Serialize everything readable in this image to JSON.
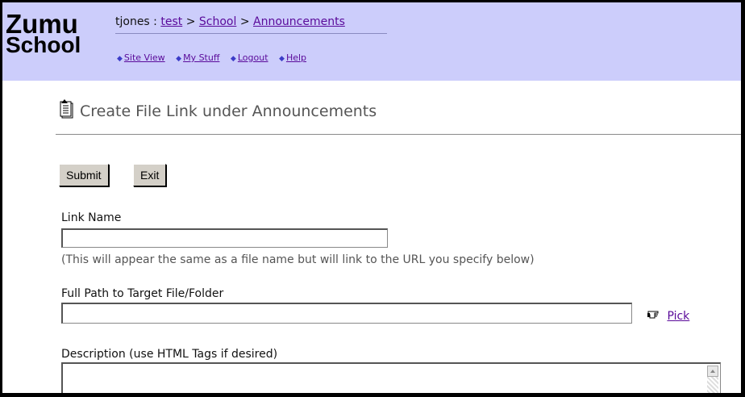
{
  "logo": {
    "line1": "Zumu",
    "line2": "School"
  },
  "breadcrumb": {
    "user": "tjones",
    "sep1": " : ",
    "link1": "test",
    "sep2": " > ",
    "link2": "School",
    "sep3": " > ",
    "link3": "Announcements"
  },
  "nav": {
    "items": [
      "Site View",
      "My Stuff",
      "Logout",
      "Help"
    ]
  },
  "heading": "Create File Link under Announcements",
  "buttons": {
    "submit": "Submit",
    "exit": "Exit"
  },
  "form": {
    "link_name_label": "Link Name",
    "link_name_value": "",
    "hint": "(This will appear the same as a file name but will link to the URL you specify below)",
    "path_label": "Full Path to Target File/Folder",
    "path_value": "",
    "pick_label": " Pick",
    "description_label": "Description (use HTML Tags if desired)",
    "description_value": ""
  },
  "colors": {
    "topbar": "#cccdfb",
    "link": "#5a0a9a"
  }
}
